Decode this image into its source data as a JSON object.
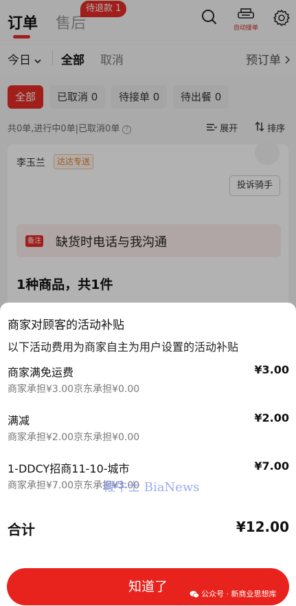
{
  "header": {
    "tabs": [
      {
        "label": "订单",
        "active": true
      },
      {
        "label": "售后",
        "active": false
      }
    ],
    "refund_badge": "待退款 1",
    "auto_accept_label": "自动接单",
    "icons": [
      "search-icon",
      "printer-icon",
      "settings-icon"
    ]
  },
  "filters": {
    "date": "今日",
    "all": "全部",
    "cancelled": "取消",
    "preorder": "预订单"
  },
  "status_chips": [
    {
      "label": "全部",
      "active": true
    },
    {
      "label": "已取消 0",
      "active": false
    },
    {
      "label": "待接单 0",
      "active": false
    },
    {
      "label": "待出餐 0",
      "active": false
    }
  ],
  "summary": {
    "text": "共0单,进行中0单|已取消0单",
    "expand": "展开",
    "sort": "排序"
  },
  "order_card": {
    "rider_name": "李玉兰",
    "delivery_tag": "达达专送",
    "complain_button": "投诉骑手",
    "remark_tag": "备注",
    "remark_text": "缺货时电话与我沟通",
    "goods_summary": "1种商品，共1件"
  },
  "sheet": {
    "title": "商家对顾客的活动补贴",
    "subtitle": "以下活动费用为商家自主为用户设置的活动补贴",
    "activities": [
      {
        "name": "商家满免运费",
        "amount": "¥3.00",
        "split": "商家承担¥3.00京东承担¥0.00"
      },
      {
        "name": "满减",
        "amount": "¥2.00",
        "split": "商家承担¥2.00京东承担¥0.00"
      },
      {
        "name": "1-DDCY招商11-10-城市",
        "amount": "¥7.00",
        "split": "商家承担¥7.00京东承担¥3.00"
      }
    ],
    "watermark": "鞭牛士 BiaNews",
    "total_label": "合计",
    "total_amount": "¥12.00",
    "ok_button": "知道了",
    "wechat_mark": "公众号 · 新商业思想库"
  },
  "colors": {
    "accent": "#e52d27",
    "overlay": "rgba(0,0,0,0.30)",
    "watermark": "#7d8ef0"
  }
}
